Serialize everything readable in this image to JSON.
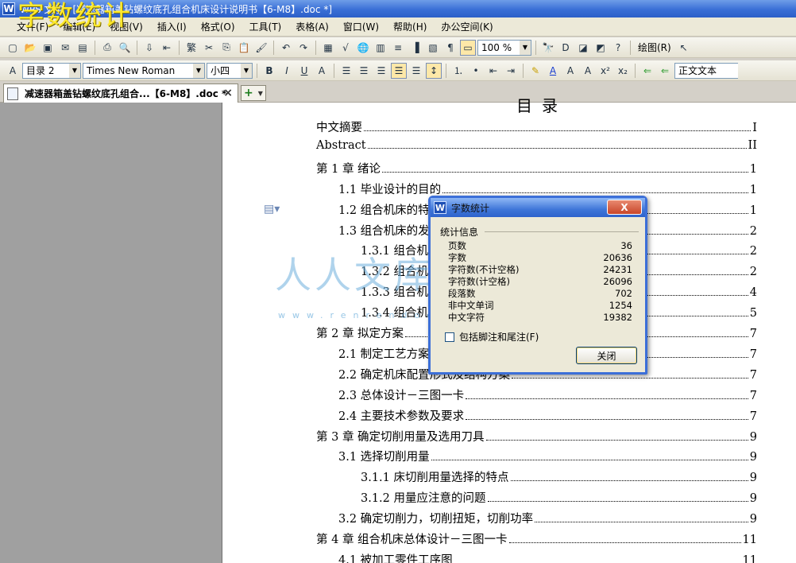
{
  "window": {
    "title": "WPS 文字 - [减速器箱盖钻螺纹底孔组合机床设计说明书【6-M8】.doc *]",
    "overlay_caption": "字数统计",
    "logo_letter": "W"
  },
  "menu": [
    "文件(F)",
    "编辑(E)",
    "视图(V)",
    "插入(I)",
    "格式(O)",
    "工具(T)",
    "表格(A)",
    "窗口(W)",
    "帮助(H)",
    "办公空间(K)"
  ],
  "toolbar1": {
    "zoom": "100 %",
    "draw_label": "绘图(R)"
  },
  "toolbar2": {
    "style": "目录 2",
    "font": "Times New Roman",
    "size": "小四",
    "bold": "B",
    "italic": "I",
    "underline": "U",
    "body_style": "正文文本"
  },
  "tab": {
    "label": "减速器箱盖钻螺纹底孔组合...【6-M8】.doc *",
    "close": "×",
    "new": "+"
  },
  "document": {
    "toc_heading": "目录",
    "toc": [
      {
        "label": "中文摘要",
        "page": "I"
      },
      {
        "label": "Abstract",
        "page": "II"
      },
      {
        "label": "第 1 章  绪论",
        "page": "1"
      },
      {
        "label": "1.1  毕业设计的目的",
        "page": "1"
      },
      {
        "label": "1.2  组合机床的特点",
        "page": "1"
      },
      {
        "label": "1.3  组合机床的发展",
        "page": "2"
      },
      {
        "label": "1.3.1  组合机",
        "page": "2"
      },
      {
        "label": "1.3.2  组合机",
        "page": "2"
      },
      {
        "label": "1.3.3  组合机",
        "page": "4"
      },
      {
        "label": "1.3.4  组合机",
        "page": "5"
      },
      {
        "label": "第 2 章  拟定方案",
        "page": "7"
      },
      {
        "label": "2.1  制定工艺方案",
        "page": "7"
      },
      {
        "label": "2.2  确定机床配置形式及结构方案",
        "page": "7"
      },
      {
        "label": "2.3  总体设计－三图一卡",
        "page": "7"
      },
      {
        "label": "2.4  主要技术参数及要求",
        "page": "7"
      },
      {
        "label": "第 3 章  确定切削用量及选用刀具",
        "page": "9"
      },
      {
        "label": "3.1  选择切削用量",
        "page": "9"
      },
      {
        "label": "3.1.1  床切削用量选择的特点",
        "page": "9"
      },
      {
        "label": "3.1.2  用量应注意的问题",
        "page": "9"
      },
      {
        "label": "3.2  确定切削力，切削扭矩，切削功率",
        "page": "9"
      },
      {
        "label": "第 4 章  组合机床总体设计－三图一卡",
        "page": "11"
      },
      {
        "label": "4.1  被加工零件工序图",
        "page": "11"
      }
    ],
    "watermark": "人人文库",
    "watermark_url": "www.renrendoc.com"
  },
  "dialog": {
    "title": "字数统计",
    "close_x": "X",
    "group_label": "统计信息",
    "stats": [
      {
        "label": "页数",
        "value": "36"
      },
      {
        "label": "字数",
        "value": "20636"
      },
      {
        "label": "字符数(不计空格)",
        "value": "24231"
      },
      {
        "label": "字符数(计空格)",
        "value": "26096"
      },
      {
        "label": "段落数",
        "value": "702"
      },
      {
        "label": "非中文单词",
        "value": "1254"
      },
      {
        "label": "中文字符",
        "value": "19382"
      }
    ],
    "include_notes_label": "包括脚注和尾注(F)",
    "include_notes_checked": false,
    "close_button": "关闭"
  }
}
